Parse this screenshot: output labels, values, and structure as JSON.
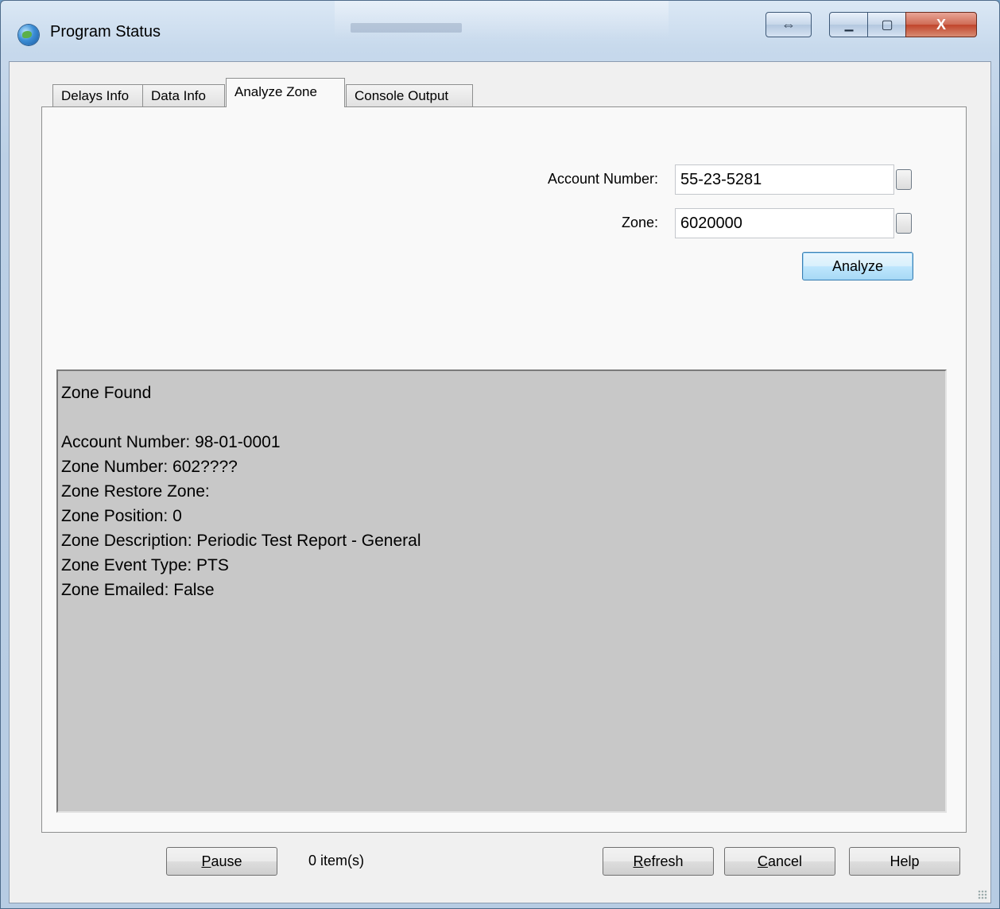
{
  "window": {
    "title": "Program Status",
    "controls": {
      "resize_symbol": "⇔",
      "minimize_symbol": "▁",
      "maximize_symbol": "▢",
      "close_symbol": "X"
    }
  },
  "tabs": [
    {
      "label": "Delays Info",
      "active": false
    },
    {
      "label": "Data Info",
      "active": false
    },
    {
      "label": "Analyze Zone",
      "active": true
    },
    {
      "label": "Console Output",
      "active": false
    }
  ],
  "form": {
    "account_label": "Account Number:",
    "account_value": "55-23-5281",
    "zone_label": "Zone:",
    "zone_value": "6020000",
    "analyze_label": "Analyze"
  },
  "result": {
    "lines": [
      "Zone Found",
      "",
      "Account Number: 98-01-0001",
      "Zone Number: 602????",
      "Zone Restore Zone:",
      "Zone Position: 0",
      "Zone Description: Periodic Test Report - General",
      "Zone Event Type: PTS",
      "Zone Emailed: False"
    ]
  },
  "footer": {
    "pause": {
      "underline": "P",
      "rest": "ause"
    },
    "item_count": "0 item(s)",
    "refresh": {
      "underline": "R",
      "rest": "efresh"
    },
    "cancel": {
      "underline": "C",
      "rest": "ancel"
    },
    "help": "Help"
  },
  "colors": {
    "result_background": "#c8c8c8",
    "panel_background": "#f9f9f9",
    "close_button": "#c0442b"
  }
}
